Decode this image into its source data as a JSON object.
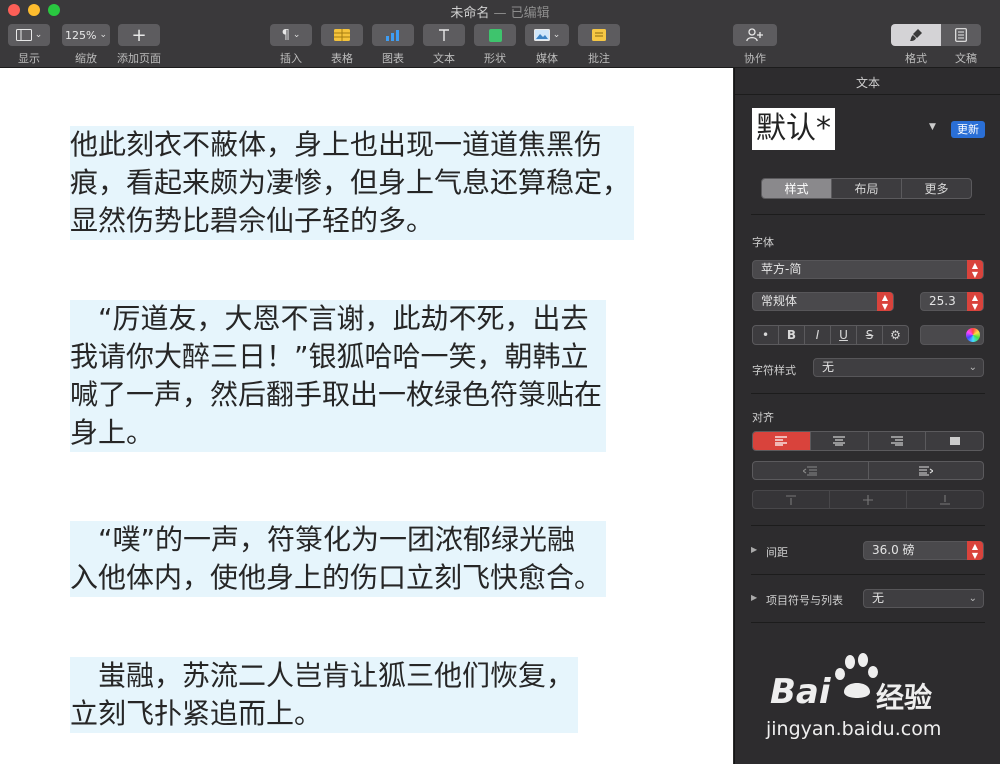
{
  "window": {
    "title": "未命名",
    "title_suffix": "— 已编辑"
  },
  "toolbar": {
    "view_label": "显示",
    "zoom_value": "125%",
    "zoom_label": "缩放",
    "add_page_label": "添加页面",
    "insert_label": "插入",
    "table_label": "表格",
    "chart_label": "图表",
    "text_label": "文本",
    "shape_label": "形状",
    "media_label": "媒体",
    "comment_label": "批注",
    "collaborate_label": "协作",
    "format_label": "格式",
    "document_label": "文稿"
  },
  "document": {
    "paragraphs": [
      {
        "lines": [
          "他此刻衣不蔽体，身上也出现一道道焦黑伤",
          "痕，看起来颇为凄惨，但身上气息还算稳定，",
          "显然伤势比碧佘仙子轻的多。"
        ]
      },
      {
        "lines": [
          "　“厉道友，大恩不言谢，此劫不死，出去",
          "我请你大醉三日！”银狐哈哈一笑，朝韩立",
          "喊了一声，然后翻手取出一枚绿色符箓贴在",
          "身上。"
        ]
      },
      {
        "lines": [
          "　“噗”的一声，符箓化为一团浓郁绿光融",
          "入他体内，使他身上的伤口立刻飞快愈合。"
        ]
      },
      {
        "lines": [
          "　蚩融，苏流二人岂肯让狐三他们恢复，",
          "立刻飞扑紧追而上。"
        ]
      }
    ]
  },
  "sidebar": {
    "section_title": "文本",
    "style_name": "默认*",
    "update_button": "更新",
    "tabs": [
      "样式",
      "布局",
      "更多"
    ],
    "font_label": "字体",
    "font_family": "苹方-简",
    "font_style": "常规体",
    "font_size": "25.3",
    "format_buttons": [
      "•",
      "B",
      "I",
      "U",
      "S",
      "⚙"
    ],
    "char_style_label": "字符样式",
    "char_style_value": "无",
    "align_label": "对齐",
    "spacing_label": "间距",
    "spacing_value": "36.0 磅",
    "bullets_label": "项目符号与列表",
    "bullets_value": "无",
    "accent_color": "#d9433c",
    "update_color": "#2a6fd6"
  },
  "watermark": {
    "brand": "Bai",
    "brand2": "经验",
    "url": "jingyan.baidu.com"
  }
}
